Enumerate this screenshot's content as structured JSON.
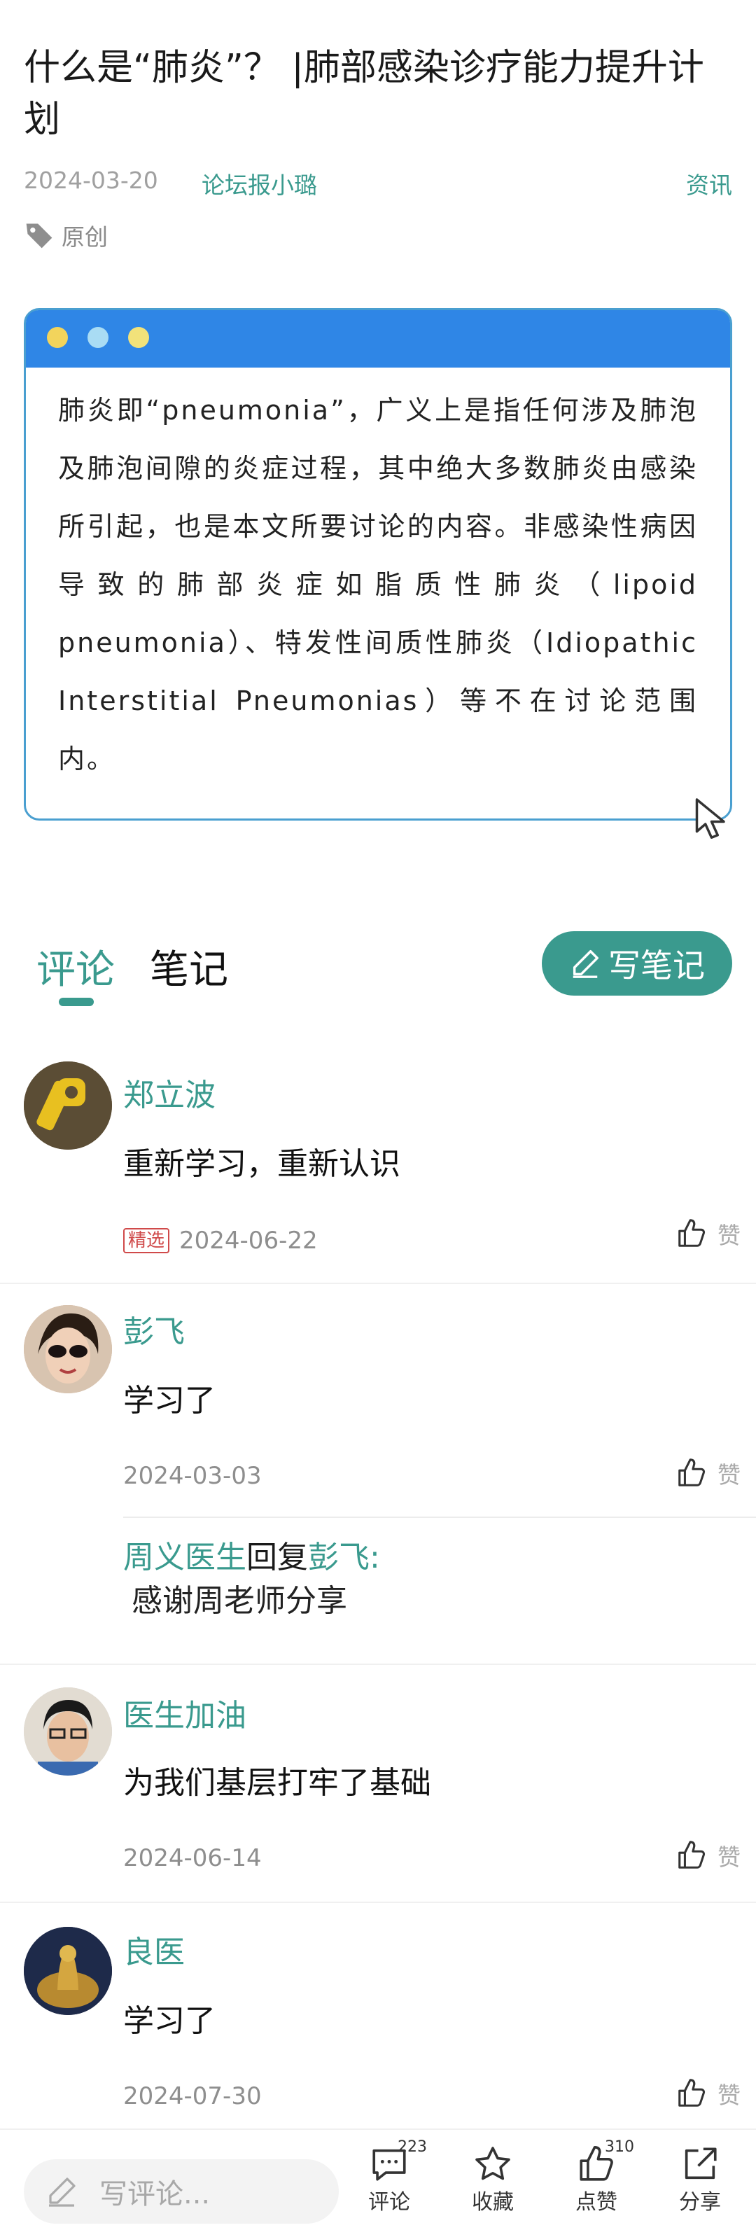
{
  "article": {
    "title": "什么是“肺炎”？ |肺部感染诊疗能力提升计划",
    "date": "2024-03-20",
    "author": "论坛报小璐",
    "category": "资讯",
    "tag": "原创",
    "body": "肺炎即“pneumonia”，广义上是指任何涉及肺泡及肺泡间隙的炎症过程，其中绝大多数肺炎由感染所引起，也是本文所要讨论的内容。非感染性病因导致的肺部炎症如脂质性肺炎（lipoid pneumonia）、特发性间质性肺炎（Idiopathic Interstitial Pneumonias）等不在讨论范围内。"
  },
  "tabs": {
    "comments": "评论",
    "notes": "笔记",
    "write_note": "写笔记"
  },
  "comments": [
    {
      "name": "郑立波",
      "text": "重新学习，重新认识",
      "badge": "精选",
      "date": "2024-06-22",
      "like": "赞"
    },
    {
      "name": "彭飞",
      "text": "学习了",
      "date": "2024-03-03",
      "like": "赞",
      "reply": {
        "from": "周义医生",
        "verb": "回复",
        "to": "彭飞:",
        "text": "感谢周老师分享"
      }
    },
    {
      "name": "医生加油",
      "text": "为我们基层打牢了基础",
      "date": "2024-06-14",
      "like": "赞"
    },
    {
      "name": "良医",
      "text": "学习了",
      "date": "2024-07-30",
      "like": "赞"
    }
  ],
  "bottom_bar": {
    "input_placeholder": "写评论...",
    "comment": {
      "label": "评论",
      "count": "223"
    },
    "favorite": {
      "label": "收藏"
    },
    "like": {
      "label": "点赞",
      "count": "310"
    },
    "share": {
      "label": "分享"
    }
  },
  "colors": {
    "accent": "#3a9a8e",
    "card_header": "#2f86e6",
    "badge": "#d04a4a"
  }
}
